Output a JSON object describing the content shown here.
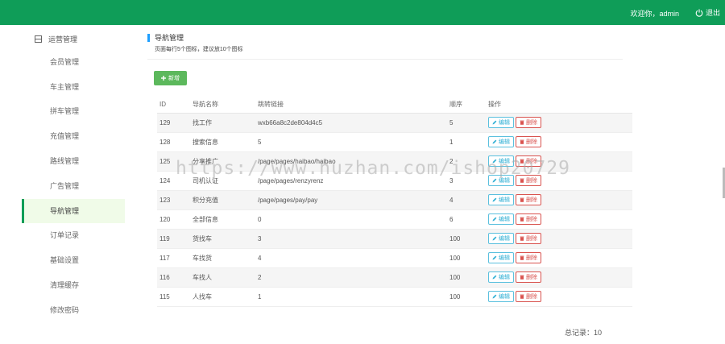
{
  "header": {
    "welcome": "欢迎你，admin",
    "logout_label": "退出",
    "bg_color": "#0f9d58"
  },
  "sidebar": {
    "group_label": "运营管理",
    "items": [
      {
        "label": "会员管理"
      },
      {
        "label": "车主管理"
      },
      {
        "label": "拼车管理"
      },
      {
        "label": "充值管理"
      },
      {
        "label": "路线管理"
      },
      {
        "label": "广告管理"
      },
      {
        "label": "导航管理",
        "active": true
      },
      {
        "label": "订单记录"
      },
      {
        "label": "基础设置"
      },
      {
        "label": "清理缓存"
      },
      {
        "label": "修改密码"
      }
    ]
  },
  "page": {
    "title": "导航管理",
    "subtitle": "页面每行5个图标，建议放10个图标",
    "add_label": "新增"
  },
  "table": {
    "headers": {
      "id": "ID",
      "name": "导航名称",
      "link": "跳转链接",
      "order": "顺序",
      "ops": "操作"
    },
    "edit_label": "编辑",
    "delete_label": "删除",
    "rows": [
      {
        "id": "129",
        "name": "找工作",
        "link": "wxb66a8c2de804d4c5",
        "order": "5"
      },
      {
        "id": "128",
        "name": "搜索信息",
        "link": "5",
        "order": "1"
      },
      {
        "id": "125",
        "name": "分享推广",
        "link": "/page/pages/haibao/haibao",
        "order": "2"
      },
      {
        "id": "124",
        "name": "司机认证",
        "link": "/page/pages/renzyrenz",
        "order": "3"
      },
      {
        "id": "123",
        "name": "积分充值",
        "link": "/page/pages/pay/pay",
        "order": "4"
      },
      {
        "id": "120",
        "name": "全部信息",
        "link": "0",
        "order": "6"
      },
      {
        "id": "119",
        "name": "货找车",
        "link": "3",
        "order": "100"
      },
      {
        "id": "117",
        "name": "车找货",
        "link": "4",
        "order": "100"
      },
      {
        "id": "116",
        "name": "车找人",
        "link": "2",
        "order": "100"
      },
      {
        "id": "115",
        "name": "人找车",
        "link": "1",
        "order": "100"
      }
    ]
  },
  "footer": {
    "total": "总记录：10"
  },
  "watermark": "https://www.huzhan.com/ishop20729"
}
